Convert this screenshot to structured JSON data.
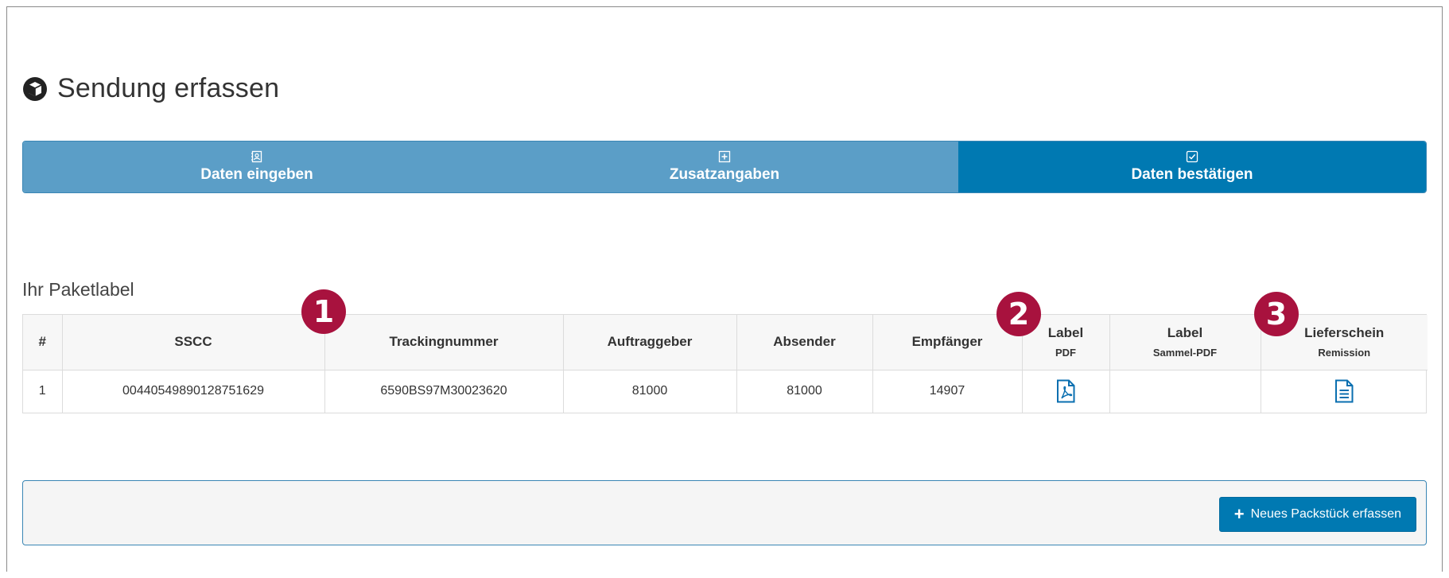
{
  "page": {
    "title": "Sendung erfassen"
  },
  "wizard": {
    "steps": [
      {
        "label": "Daten eingeben",
        "icon": "contact-book-icon",
        "state": "inactive"
      },
      {
        "label": "Zusatzangaben",
        "icon": "plus-square-icon",
        "state": "inactive"
      },
      {
        "label": "Daten bestätigen",
        "icon": "check-square-icon",
        "state": "active"
      }
    ]
  },
  "section": {
    "title": "Ihr Paketlabel"
  },
  "table": {
    "headers": {
      "index": "#",
      "sscc": "SSCC",
      "tracking": "Trackingnummer",
      "client": "Auftraggeber",
      "sender": "Absender",
      "recipient": "Empfänger",
      "label_pdf": {
        "main": "Label",
        "sub": "PDF"
      },
      "label_collective": {
        "main": "Label",
        "sub": "Sammel-PDF"
      },
      "delivery_note": {
        "main": "Lieferschein",
        "sub": "Remission"
      }
    },
    "rows": [
      {
        "index": "1",
        "sscc": "00440549890128751629",
        "tracking": "6590BS97M30023620",
        "client": "81000",
        "sender": "81000",
        "recipient": "14907"
      }
    ]
  },
  "badges": {
    "one": "1",
    "two": "2",
    "three": "3"
  },
  "footer": {
    "add_button_label": "Neues Packstück erfassen"
  },
  "colors": {
    "primary": "#0079b2",
    "step_inactive": "#5b9ec7",
    "badge": "#a8123e"
  }
}
